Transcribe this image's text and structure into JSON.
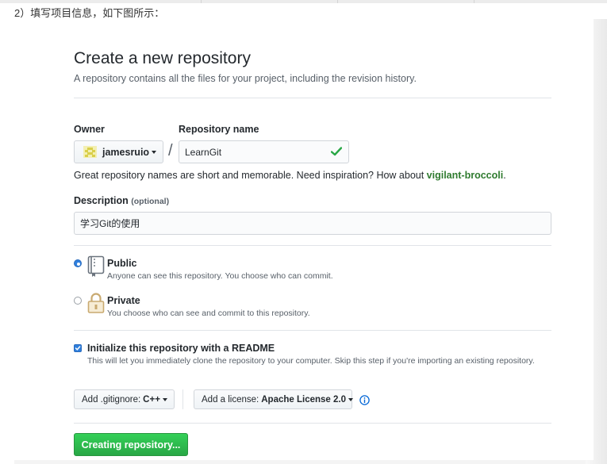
{
  "intro_text": "2）填写项目信息，如下图所示：",
  "page": {
    "title": "Create a new repository",
    "subtitle": "A repository contains all the files for your project, including the revision history."
  },
  "owner": {
    "label": "Owner",
    "value": "jamesruio"
  },
  "separator": "/",
  "repo_name": {
    "label": "Repository name",
    "value": "LearnGit"
  },
  "hint": {
    "text": "Great repository names are short and memorable. Need inspiration? How about ",
    "suggestion": "vigilant-broccoli",
    "end": "."
  },
  "description": {
    "label": "Description",
    "optional": "(optional)",
    "value": "学习Git的使用"
  },
  "visibility": {
    "public": {
      "label": "Public",
      "desc": "Anyone can see this repository. You choose who can commit.",
      "selected": true
    },
    "private": {
      "label": "Private",
      "desc": "You choose who can see and commit to this repository.",
      "selected": false
    }
  },
  "readme": {
    "label": "Initialize this repository with a README",
    "desc": "This will let you immediately clone the repository to your computer. Skip this step if you're importing an existing repository.",
    "checked": true
  },
  "gitignore": {
    "prefix": "Add .gitignore:",
    "value": "C++"
  },
  "license": {
    "prefix": "Add a license:",
    "value": "Apache License 2.0"
  },
  "submit": {
    "label": "Creating repository..."
  },
  "colors": {
    "accent": "#0366d6",
    "success": "#28a745",
    "suggestion": "#2f7b2f",
    "border": "#e1e4e8"
  },
  "icons": {
    "valid": "check-icon",
    "public": "repo-book-icon",
    "private": "lock-icon",
    "info": "info-icon"
  }
}
